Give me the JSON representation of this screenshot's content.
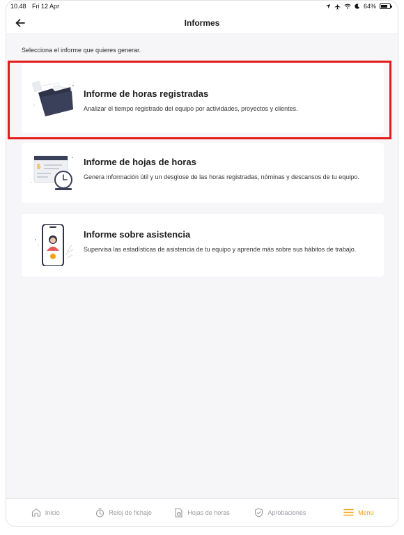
{
  "status_bar": {
    "time": "10.48",
    "date": "Fri 12 Apr",
    "battery": "64%"
  },
  "header": {
    "title": "Informes"
  },
  "intro": "Selecciona el informe que quieres generar.",
  "reports": [
    {
      "title": "Informe de horas registradas",
      "description": "Analizar el tiempo registrado del equipo por actividades, proyectos y clientes.",
      "icon": "folder-illustration"
    },
    {
      "title": "Informe de hojas de horas",
      "description": "Genera información útil y un desglose de las horas registradas, nóminas y descansos de tu equipo.",
      "icon": "timesheet-clock-illustration"
    },
    {
      "title": "Informe sobre asistencia",
      "description": "Supervisa las estadísticas de asistencia de tu equipo y aprende más sobre sus hábitos de trabajo.",
      "icon": "phone-person-illustration"
    }
  ],
  "tabs": [
    {
      "label": "Inicio",
      "icon": "home-icon",
      "active": false
    },
    {
      "label": "Reloj de fichaje",
      "icon": "stopwatch-icon",
      "active": false
    },
    {
      "label": "Hojas de horas",
      "icon": "timesheet-icon",
      "active": false
    },
    {
      "label": "Aprobaciones",
      "icon": "shield-check-icon",
      "active": false
    },
    {
      "label": "Menú",
      "icon": "menu-icon",
      "active": true
    }
  ],
  "colors": {
    "accent": "#f5a31a",
    "highlight": "#e41b1b",
    "background": "#f6f6f8"
  }
}
